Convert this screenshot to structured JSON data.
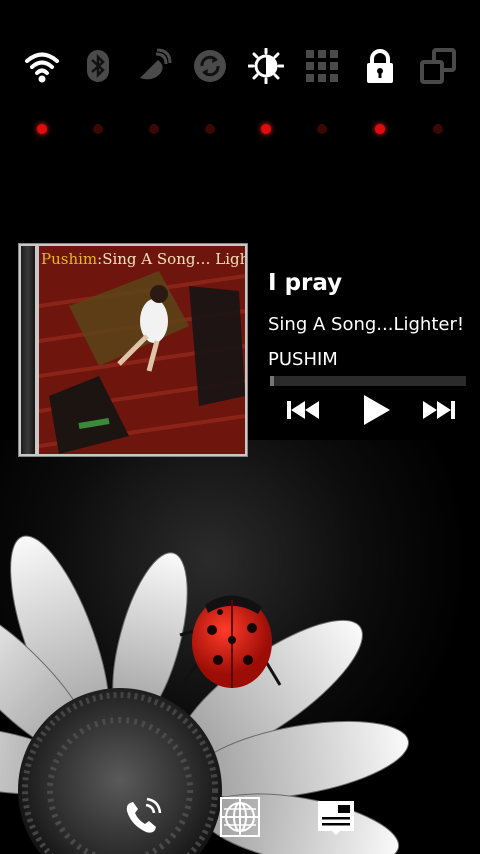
{
  "power_widget": {
    "toggles": [
      {
        "icon": "wifi-icon",
        "on": true
      },
      {
        "icon": "bluetooth-icon",
        "on": false
      },
      {
        "icon": "gps-icon",
        "on": false
      },
      {
        "icon": "sync-icon",
        "on": false
      },
      {
        "icon": "brightness-icon",
        "on": true
      },
      {
        "icon": "data-icon",
        "on": false
      },
      {
        "icon": "lock-icon",
        "on": true
      },
      {
        "icon": "rotation-icon",
        "on": false
      }
    ],
    "indicator_on_color": "#e10b0b",
    "indicator_off_color": "#3a0606"
  },
  "music_widget": {
    "album_cover": {
      "artist_text": "Pushim",
      "title_text": "Sing A Song… Lighter!"
    },
    "track_title": "I pray",
    "album": "Sing A Song...Lighter!",
    "artist": "PUSHIM",
    "progress": 0.02,
    "controls": [
      "previous-icon",
      "play-icon",
      "next-icon"
    ]
  },
  "dock": {
    "items": [
      "phone-icon",
      "browser-icon",
      "messages-icon"
    ]
  }
}
